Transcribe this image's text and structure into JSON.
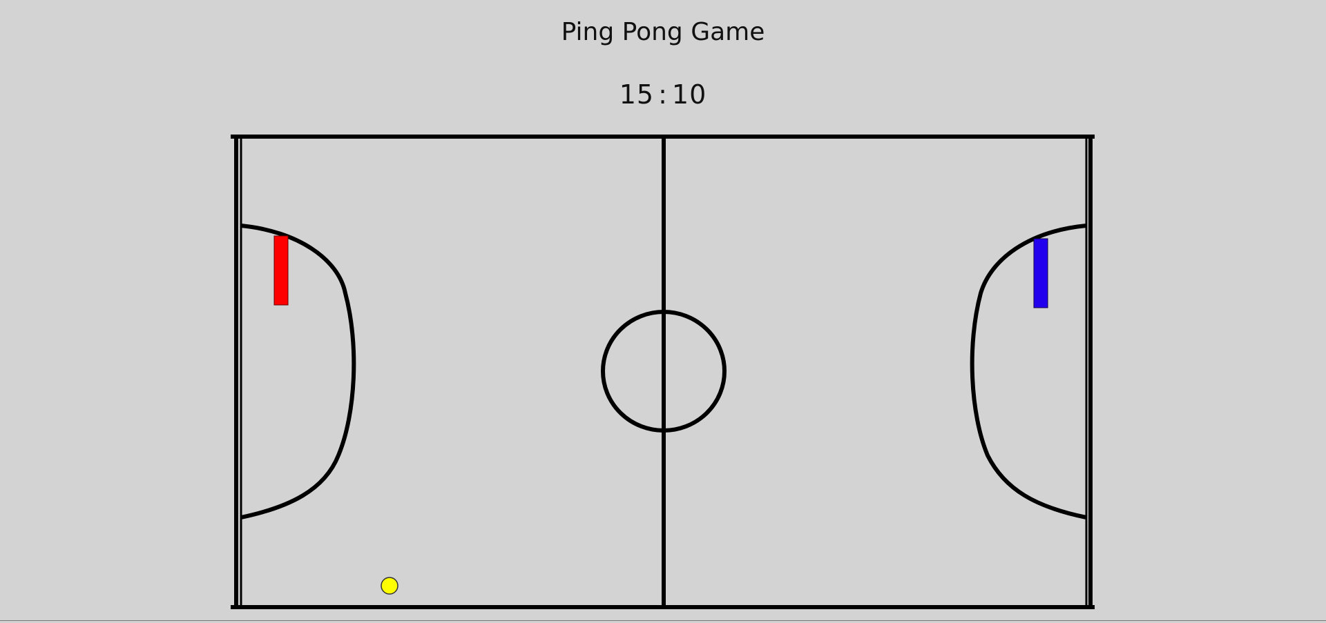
{
  "game": {
    "title": "Ping Pong Game",
    "score": {
      "left": "15",
      "separator": ":",
      "right": "10"
    }
  },
  "colors": {
    "background": "#d3d3d3",
    "lines": "#000000",
    "left_paddle": "#ff0000",
    "right_paddle": "#2200ee",
    "ball": "#ffff00"
  }
}
